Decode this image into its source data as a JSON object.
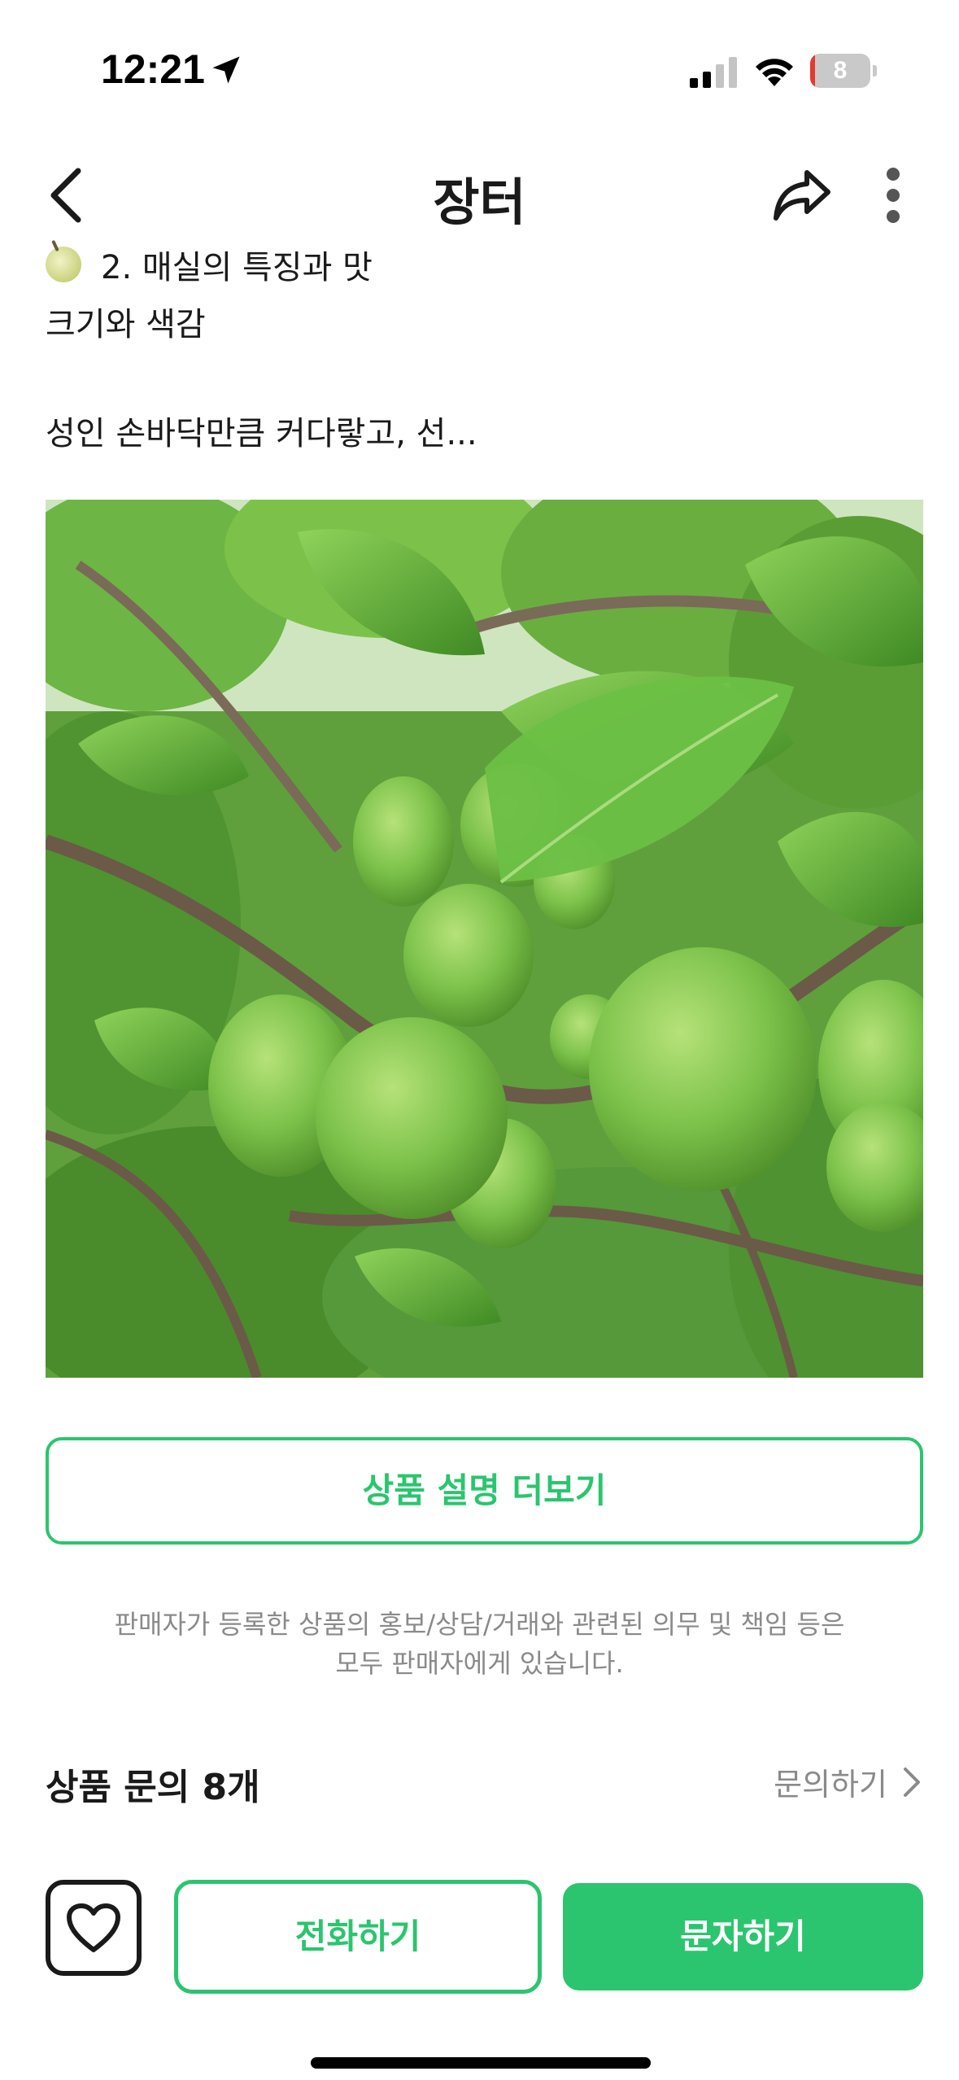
{
  "status_bar": {
    "time": "12:21",
    "battery_level": "8",
    "battery_fraction": 0.08,
    "signal_bars": 2,
    "icons": [
      "location-arrow-icon",
      "cellular-signal-icon",
      "wifi-icon",
      "battery-icon"
    ]
  },
  "nav": {
    "title": "장터",
    "icons": [
      "back-icon",
      "share-icon",
      "more-vertical-icon"
    ]
  },
  "content": {
    "section_heading": "2. 매실의 특징과 맛",
    "sub_heading": "크기와 색감",
    "preview_text": "성인 손바닥만큼 커다랗고, 선...",
    "image": "green-plums-on-tree"
  },
  "more_description_label": "상품 설명 더보기",
  "disclaimer": {
    "line1": "판매자가 등록한 상품의 홍보/상담/거래와 관련된 의무 및 책임 등은",
    "line2": "모두 판매자에게 있습니다."
  },
  "inquiry": {
    "title": "상품 문의 8개",
    "link_label": "문의하기"
  },
  "bottom_bar": {
    "favorite_icon": "heart-icon",
    "call_label": "전화하기",
    "sms_label": "문자하기"
  },
  "colors": {
    "accent": "#2bc56f",
    "text": "#1a1a1a",
    "muted": "#8a8a8a",
    "battery_low": "#e23b2f"
  }
}
